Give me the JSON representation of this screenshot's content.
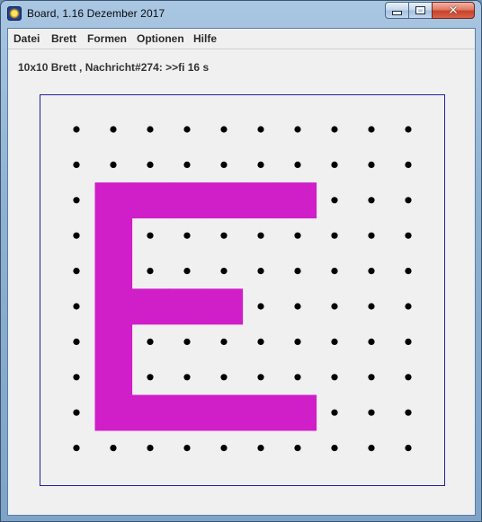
{
  "window": {
    "title": "Board, 1.16 Dezember 2017",
    "icon": "app-board-icon",
    "controls": {
      "minimize": "minimize-icon",
      "maximize": "maximize-icon",
      "close": "close-icon"
    }
  },
  "menu": {
    "items": [
      "Datei",
      "Brett",
      "Formen",
      "Optionen",
      "Hilfe"
    ]
  },
  "status": {
    "text": "10x10 Brett , Nachricht#274: >>fi 16 s"
  },
  "board": {
    "rows": 10,
    "cols": 10,
    "dot_color": "#000000",
    "shape_color": "#d01ec8",
    "frame_color": "#2020a0",
    "shape_letter": "E",
    "covered_cells": [
      [
        2,
        1
      ],
      [
        2,
        2
      ],
      [
        2,
        3
      ],
      [
        2,
        4
      ],
      [
        2,
        5
      ],
      [
        2,
        6
      ],
      [
        3,
        1
      ],
      [
        4,
        1
      ],
      [
        5,
        1
      ],
      [
        5,
        2
      ],
      [
        5,
        3
      ],
      [
        5,
        4
      ],
      [
        6,
        1
      ],
      [
        7,
        1
      ],
      [
        8,
        1
      ],
      [
        8,
        2
      ],
      [
        8,
        3
      ],
      [
        8,
        4
      ],
      [
        8,
        5
      ],
      [
        8,
        6
      ]
    ]
  }
}
